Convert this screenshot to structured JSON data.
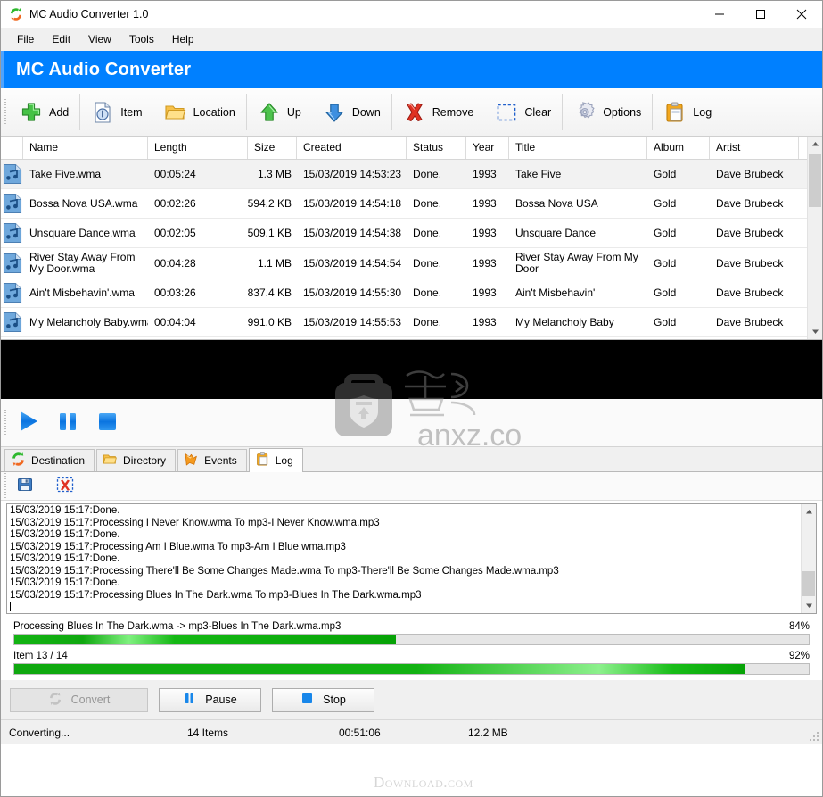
{
  "window": {
    "title": "MC Audio Converter 1.0",
    "app_icon": "app-logo-icon",
    "minimize": "minimize-icon",
    "maximize": "maximize-icon",
    "close": "close-icon"
  },
  "menu": {
    "items": [
      "File",
      "Edit",
      "View",
      "Tools",
      "Help"
    ]
  },
  "banner": {
    "title": "MC Audio Converter",
    "bg": "#0080ff"
  },
  "toolbar": {
    "groups": [
      {
        "buttons": [
          {
            "label": "Add",
            "icon": "plus-icon"
          }
        ]
      },
      {
        "buttons": [
          {
            "label": "Item",
            "icon": "file-info-icon"
          },
          {
            "label": "Location",
            "icon": "folder-icon"
          }
        ]
      },
      {
        "buttons": [
          {
            "label": "Up",
            "icon": "arrow-up-icon"
          },
          {
            "label": "Down",
            "icon": "arrow-down-icon"
          }
        ]
      },
      {
        "buttons": [
          {
            "label": "Remove",
            "icon": "red-x-icon"
          },
          {
            "label": "Clear",
            "icon": "dashed-square-icon"
          }
        ]
      },
      {
        "buttons": [
          {
            "label": "Options",
            "icon": "gear-icon"
          }
        ]
      },
      {
        "buttons": [
          {
            "label": "Log",
            "icon": "clipboard-icon"
          }
        ]
      }
    ]
  },
  "file_list": {
    "columns": [
      "",
      "Name",
      "Length",
      "Size",
      "Created",
      "Status",
      "Year",
      "Title",
      "Album",
      "Artist"
    ],
    "rows": [
      {
        "icon": "audio-file-icon",
        "name": "Take Five.wma",
        "length": "00:05:24",
        "size": "1.3 MB",
        "created": "15/03/2019 14:53:23",
        "status": "Done.",
        "year": "1993",
        "title": "Take Five",
        "album": "Gold",
        "artist": "Dave Brubeck",
        "selected": true
      },
      {
        "icon": "audio-file-icon",
        "name": "Bossa Nova USA.wma",
        "length": "00:02:26",
        "size": "594.2 KB",
        "created": "15/03/2019 14:54:18",
        "status": "Done.",
        "year": "1993",
        "title": "Bossa Nova USA",
        "album": "Gold",
        "artist": "Dave Brubeck",
        "selected": false
      },
      {
        "icon": "audio-file-icon",
        "name": "Unsquare Dance.wma",
        "length": "00:02:05",
        "size": "509.1 KB",
        "created": "15/03/2019 14:54:38",
        "status": "Done.",
        "year": "1993",
        "title": "Unsquare Dance",
        "album": "Gold",
        "artist": "Dave Brubeck",
        "selected": false
      },
      {
        "icon": "audio-file-icon",
        "name": "River Stay Away From My Door.wma",
        "length": "00:04:28",
        "size": "1.1 MB",
        "created": "15/03/2019 14:54:54",
        "status": "Done.",
        "year": "1993",
        "title": "River Stay Away From My Door",
        "album": "Gold",
        "artist": "Dave Brubeck",
        "selected": false
      },
      {
        "icon": "audio-file-icon",
        "name": "Ain't Misbehavin'.wma",
        "length": "00:03:26",
        "size": "837.4 KB",
        "created": "15/03/2019 14:55:30",
        "status": "Done.",
        "year": "1993",
        "title": "Ain't Misbehavin'",
        "album": "Gold",
        "artist": "Dave Brubeck",
        "selected": false
      },
      {
        "icon": "audio-file-icon",
        "name": "My Melancholy Baby.wma",
        "length": "00:04:04",
        "size": "991.0 KB",
        "created": "15/03/2019 14:55:53",
        "status": "Done.",
        "year": "1993",
        "title": "My Melancholy Baby",
        "album": "Gold",
        "artist": "Dave Brubeck",
        "selected": false
      }
    ]
  },
  "player": {
    "buttons": [
      {
        "name": "play-button",
        "icon": "play-icon"
      },
      {
        "name": "pause-button",
        "icon": "pause-icon"
      },
      {
        "name": "stop-button",
        "icon": "stop-icon"
      }
    ]
  },
  "tabs": [
    {
      "label": "Destination",
      "icon": "convert-arrows-icon",
      "active": false
    },
    {
      "label": "Directory",
      "icon": "folder-icon",
      "active": false
    },
    {
      "label": "Events",
      "icon": "events-lightning-icon",
      "active": false
    },
    {
      "label": "Log",
      "icon": "clipboard-icon",
      "active": true
    }
  ],
  "log_toolbar": {
    "buttons": [
      {
        "label": "",
        "icon": "save-disk-icon",
        "name": "save-log-button"
      },
      {
        "label": "",
        "icon": "clear-log-icon",
        "name": "clear-log-button"
      }
    ]
  },
  "log": {
    "lines": [
      "15/03/2019 15:17:Done.",
      "15/03/2019 15:17:Processing I Never Know.wma To mp3-I Never Know.wma.mp3",
      "15/03/2019 15:17:Done.",
      "15/03/2019 15:17:Processing Am I Blue.wma To mp3-Am I Blue.wma.mp3",
      "15/03/2019 15:17:Done.",
      "15/03/2019 15:17:Processing There'll Be Some Changes Made.wma To mp3-There'll Be Some Changes Made.wma.mp3",
      "15/03/2019 15:17:Done.",
      "15/03/2019 15:17:Processing Blues In The Dark.wma To mp3-Blues In The Dark.wma.mp3"
    ]
  },
  "progress": {
    "file": {
      "label": "Processing Blues In The Dark.wma -> mp3-Blues In The Dark.wma.mp3",
      "percent_text": "84%",
      "fill_percent": 48
    },
    "overall": {
      "label": "Item 13 / 14",
      "percent_text": "92%",
      "fill_percent": 92
    }
  },
  "actions": {
    "convert": {
      "label": "Convert",
      "icon": "convert-arrows-icon",
      "disabled": true
    },
    "pause": {
      "label": "Pause",
      "icon": "pause-icon",
      "disabled": false
    },
    "stop": {
      "label": "Stop",
      "icon": "stop-icon",
      "disabled": false
    }
  },
  "status_bar": {
    "state": "Converting...",
    "items": "14 Items",
    "elapsed": "00:51:06",
    "size": "12.2 MB"
  },
  "watermarks": {
    "center_text": "anxz.com",
    "bottom_text": "Download.com"
  }
}
